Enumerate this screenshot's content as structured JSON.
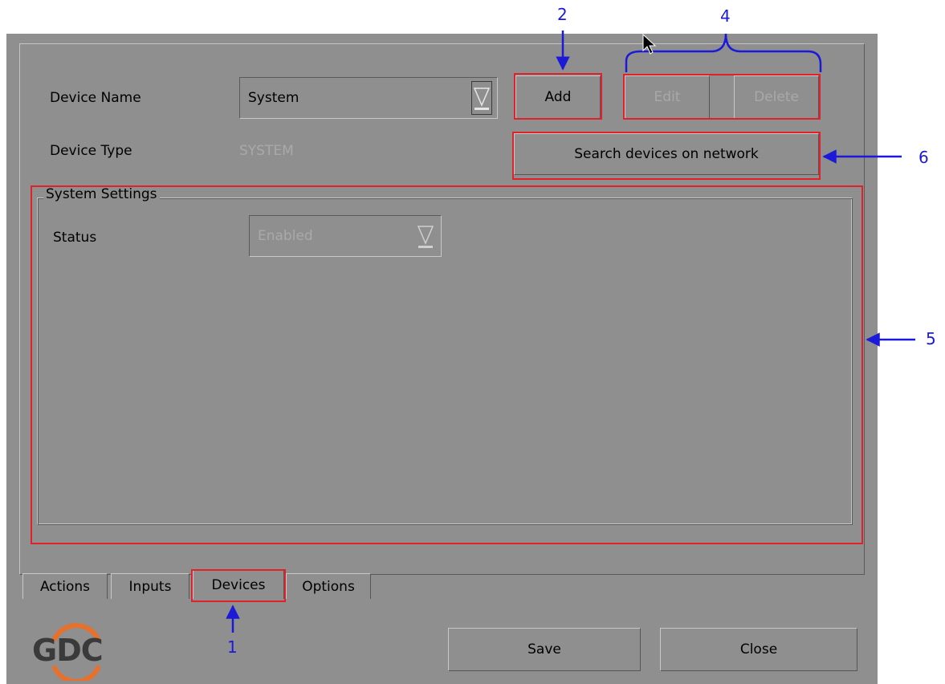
{
  "device_name": {
    "label": "Device Name",
    "value": "System"
  },
  "device_type": {
    "label": "Device Type",
    "value": "SYSTEM"
  },
  "buttons": {
    "add": "Add",
    "edit": "Edit",
    "delete": "Delete",
    "search": "Search devices on network",
    "save": "Save",
    "close": "Close"
  },
  "system_settings": {
    "title": "System Settings",
    "status_label": "Status",
    "status_value": "Enabled"
  },
  "tabs": [
    "Actions",
    "Inputs",
    "Devices",
    "Options"
  ],
  "active_tab": "Devices",
  "logo": {
    "text": "GDC",
    "ring_color": "#e8702a"
  },
  "annotations": [
    "1",
    "2",
    "4",
    "5",
    "6"
  ],
  "colors": {
    "highlight": "#e0202a",
    "annotation": "#1a1ad8",
    "window_bg": "#8f8f8f"
  }
}
